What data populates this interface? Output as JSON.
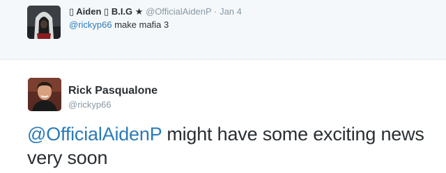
{
  "reply": {
    "name": "Aiden",
    "name_suffix": "B.I.G",
    "box_glyph": "▯",
    "star_glyph": "★",
    "handle": "@OfficialAidenP",
    "separator": "·",
    "date": "Jan 4",
    "mention": "@rickyp66",
    "text": " make mafia 3"
  },
  "tweet": {
    "name": "Rick Pasqualone",
    "handle": "@rickyp66",
    "mention": "@OfficialAidenP",
    "text": " might have some exciting news very soon"
  }
}
